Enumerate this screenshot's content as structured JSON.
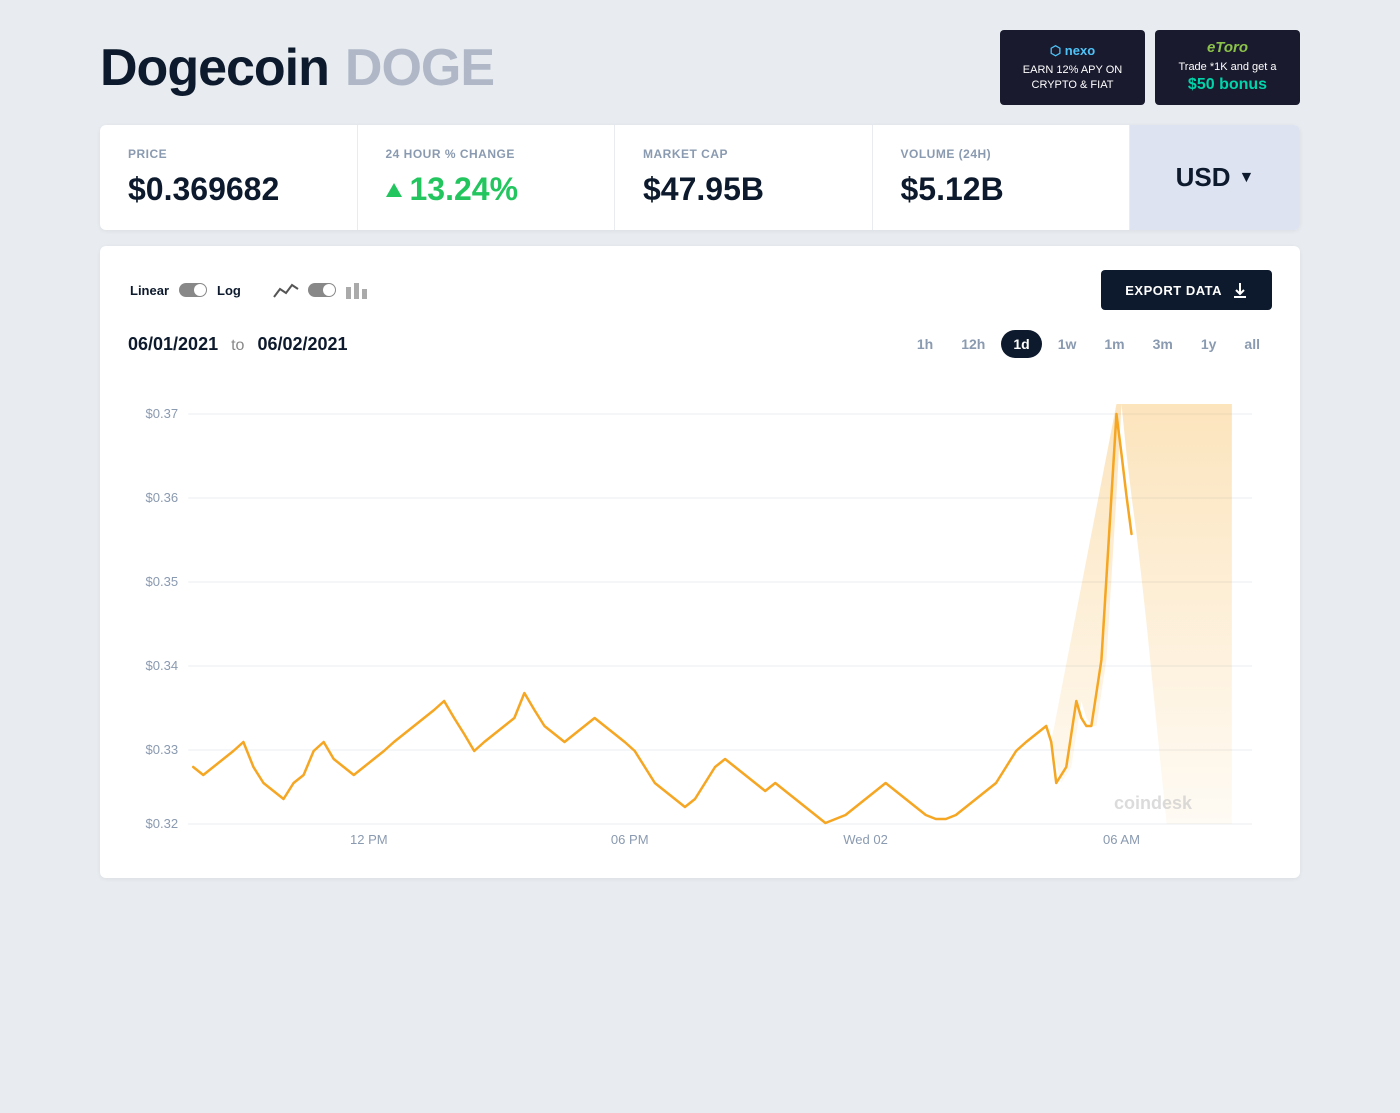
{
  "header": {
    "coin_name": "Dogecoin",
    "coin_ticker": "DOGE"
  },
  "ads": [
    {
      "id": "nexo",
      "logo": "nexo",
      "line1": "EARN 12% APY ON",
      "line2": "CRYPTO & FIAT"
    },
    {
      "id": "etoro",
      "logo": "eToro",
      "line1": "Trade *1K and get a",
      "line2": "$50 bonus"
    }
  ],
  "stats": {
    "price_label": "PRICE",
    "price_value": "$0.369682",
    "change_label": "24 HOUR % CHANGE",
    "change_value": "13.24%",
    "marketcap_label": "MARKET CAP",
    "marketcap_value": "$47.95B",
    "volume_label": "VOLUME (24H)",
    "volume_value": "$5.12B",
    "currency_label": "USD"
  },
  "chart": {
    "scale_linear": "Linear",
    "scale_log": "Log",
    "export_label": "EXPORT DATA",
    "date_from": "06/01/2021",
    "date_to": "06/02/2021",
    "date_separator": "to",
    "time_buttons": [
      "1h",
      "12h",
      "1d",
      "1w",
      "1m",
      "3m",
      "1y",
      "all"
    ],
    "active_time": "1d",
    "x_labels": [
      "12 PM",
      "06 PM",
      "Wed 02",
      "06 AM"
    ],
    "y_labels": [
      "$0.37",
      "$0.36",
      "$0.35",
      "$0.34",
      "$0.33",
      "$0.32"
    ],
    "watermark": "coindesk"
  }
}
